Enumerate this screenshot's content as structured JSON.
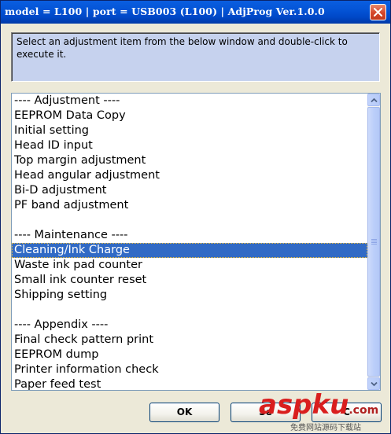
{
  "window": {
    "title": "model = L100 | port = USB003 (L100) | AdjProg Ver.1.0.0"
  },
  "instruction": {
    "text": "Select an adjustment item from the below window and double-click to execute it."
  },
  "list": {
    "items": [
      "---- Adjustment ----",
      "EEPROM Data Copy",
      "Initial setting",
      "Head ID input",
      "Top margin adjustment",
      "Head angular adjustment",
      "Bi-D adjustment",
      "PF band adjustment",
      "",
      "---- Maintenance ----",
      "Cleaning/Ink Charge",
      "Waste ink pad counter",
      "Small ink counter reset",
      "Shipping setting",
      "",
      "---- Appendix ----",
      "Final check pattern print",
      "EEPROM dump",
      "Printer information check",
      "Paper feed test"
    ],
    "selected_index": 10
  },
  "buttons": {
    "ok": "OK",
    "setting": "Se",
    "cancel": "C"
  },
  "watermark": {
    "main_a": "asp",
    "main_b": "ku",
    "main_c": ".com",
    "sub": "免费网站源码下载站"
  },
  "colors": {
    "titlebar": "#0454d6",
    "selection": "#316ac5",
    "instruction_bg": "#c6d2ee",
    "watermark": "#d91e1e"
  },
  "icons": {
    "close": "close-icon",
    "scroll_up": "arrow-up-icon",
    "scroll_down": "arrow-down-icon"
  }
}
